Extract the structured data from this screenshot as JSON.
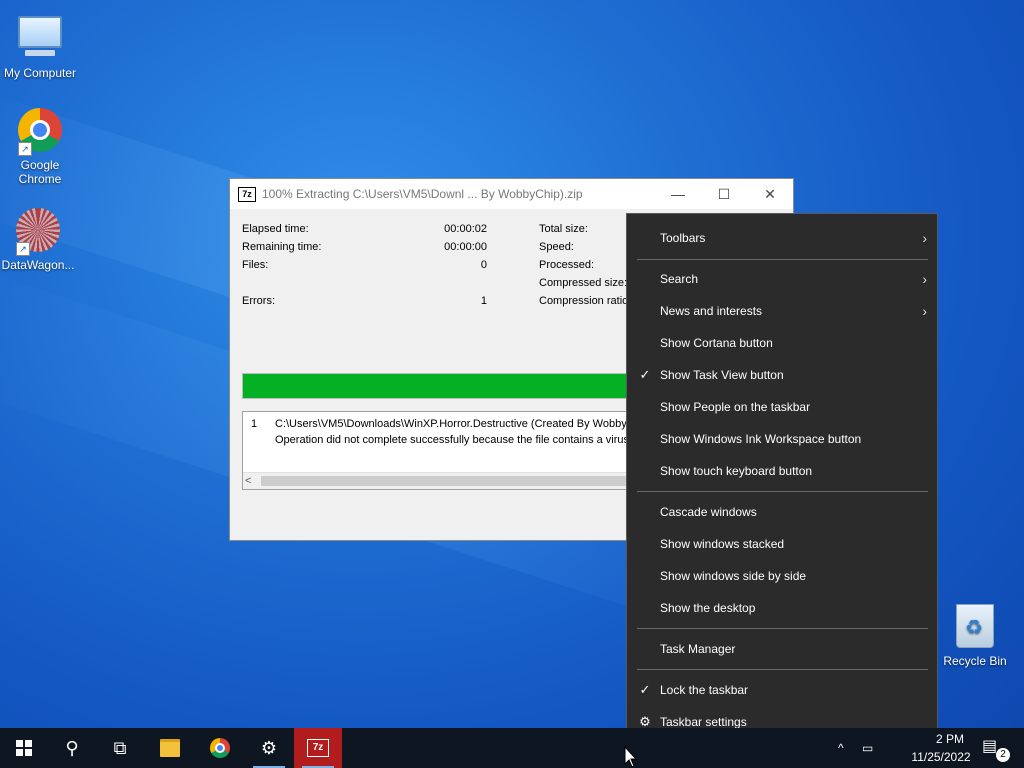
{
  "desktop": {
    "icons": [
      {
        "label": "My Computer",
        "icon": "computer-icon"
      },
      {
        "label": "Google Chrome",
        "icon": "chrome-icon"
      },
      {
        "label": "DataWagon...",
        "icon": "datawagon-icon"
      },
      {
        "label": "Recycle Bin",
        "icon": "recycle-bin-icon"
      }
    ]
  },
  "extract_window": {
    "title": "100% Extracting C:\\Users\\VM5\\Downl ... By WobbyChip).zip",
    "app_icon_text": "7z",
    "buttons": {
      "minimize": "—",
      "maximize": "☐",
      "close": "✕"
    },
    "left_stats": [
      {
        "label": "Elapsed time:",
        "value": "00:00:02"
      },
      {
        "label": "Remaining time:",
        "value": "00:00:00"
      },
      {
        "label": "Files:",
        "value": "0"
      },
      {
        "label": "Errors:",
        "value": "1"
      }
    ],
    "right_stats": [
      {
        "label": "Total size:"
      },
      {
        "label": "Speed:"
      },
      {
        "label": "Processed:"
      },
      {
        "label": "Compressed size:"
      },
      {
        "label": "Compression ratio:"
      }
    ],
    "progress_fraction": 1.0,
    "messages": {
      "index": "1",
      "line1": "C:\\Users\\VM5\\Downloads\\WinXP.Horror.Destructive  (Created By Wobby",
      "line2": "Operation did not complete successfully because the file contains a virus o"
    },
    "scroll_left": "<"
  },
  "context_menu": {
    "items": [
      {
        "label": "Toolbars",
        "submenu": true,
        "checked": false
      },
      {
        "label": "Search",
        "submenu": true,
        "checked": false
      },
      {
        "label": "News and interests",
        "submenu": true,
        "checked": false
      },
      {
        "label": "Show Cortana button",
        "submenu": false,
        "checked": false
      },
      {
        "label": "Show Task View button",
        "submenu": false,
        "checked": true
      },
      {
        "label": "Show People on the taskbar",
        "submenu": false,
        "checked": false
      },
      {
        "label": "Show Windows Ink Workspace button",
        "submenu": false,
        "checked": false
      },
      {
        "label": "Show touch keyboard button",
        "submenu": false,
        "checked": false
      },
      {
        "label": "Cascade windows",
        "submenu": false,
        "checked": false
      },
      {
        "label": "Show windows stacked",
        "submenu": false,
        "checked": false
      },
      {
        "label": "Show windows side by side",
        "submenu": false,
        "checked": false
      },
      {
        "label": "Show the desktop",
        "submenu": false,
        "checked": false
      },
      {
        "label": "Task Manager",
        "submenu": false,
        "checked": false
      },
      {
        "label": "Lock the taskbar",
        "submenu": false,
        "checked": true
      },
      {
        "label": "Taskbar settings",
        "submenu": false,
        "checked": false,
        "icon": "gear-icon"
      }
    ],
    "check_glyph": "✓",
    "submenu_glyph": "›",
    "gear_glyph": "⚙"
  },
  "taskbar": {
    "search_glyph": "⚲",
    "taskview_glyph": "⧉",
    "settings_glyph": "⚙",
    "sevenz_text": "7z",
    "tray_chevron": "^",
    "clock_time": "2 PM",
    "clock_date": "11/25/2022",
    "notification_count": "2",
    "notification_glyph": "▤"
  }
}
